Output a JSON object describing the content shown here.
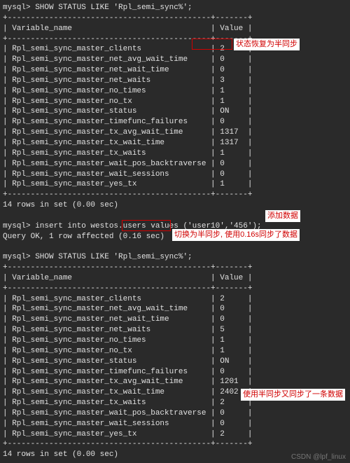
{
  "prompt1": "mysql> SHOW STATUS LIKE 'Rpl_semi_sync%';",
  "header1": "| Variable_name                              | Value |",
  "sep_top1": "+--------------------------------------------+-------+",
  "sep_mid1": "+--------------------------------------------+-------+",
  "sep_bot1": "+--------------------------------------------+-------+",
  "rows1": [
    "| Rpl_semi_sync_master_clients               | 2     |",
    "| Rpl_semi_sync_master_net_avg_wait_time     | 0     |",
    "| Rpl_semi_sync_master_net_wait_time         | 0     |",
    "| Rpl_semi_sync_master_net_waits             | 3     |",
    "| Rpl_semi_sync_master_no_times              | 1     |",
    "| Rpl_semi_sync_master_no_tx                 | 1     |",
    "| Rpl_semi_sync_master_status                | ON    |",
    "| Rpl_semi_sync_master_timefunc_failures     | 0     |",
    "| Rpl_semi_sync_master_tx_avg_wait_time      | 1317  |",
    "| Rpl_semi_sync_master_tx_wait_time          | 1317  |",
    "| Rpl_semi_sync_master_tx_waits              | 1     |",
    "| Rpl_semi_sync_master_wait_pos_backtraverse | 0     |",
    "| Rpl_semi_sync_master_wait_sessions         | 0     |",
    "| Rpl_semi_sync_master_yes_tx                | 1     |"
  ],
  "footer1": "14 rows in set (0.00 sec)",
  "prompt2": "mysql> insert into westos.users values ('user10','456');",
  "result2": "Query OK, 1 row affected (0.16 sec)",
  "prompt3": "mysql> SHOW STATUS LIKE 'Rpl_semi_sync%';",
  "header2": "| Variable_name                              | Value |",
  "rows2": [
    "| Rpl_semi_sync_master_clients               | 2     |",
    "| Rpl_semi_sync_master_net_avg_wait_time     | 0     |",
    "| Rpl_semi_sync_master_net_wait_time         | 0     |",
    "| Rpl_semi_sync_master_net_waits             | 5     |",
    "| Rpl_semi_sync_master_no_times              | 1     |",
    "| Rpl_semi_sync_master_no_tx                 | 1     |",
    "| Rpl_semi_sync_master_status                | ON    |",
    "| Rpl_semi_sync_master_timefunc_failures     | 0     |",
    "| Rpl_semi_sync_master_tx_avg_wait_time      | 1201  |",
    "| Rpl_semi_sync_master_tx_wait_time          | 2402  |",
    "| Rpl_semi_sync_master_tx_waits              | 2     |",
    "| Rpl_semi_sync_master_wait_pos_backtraverse | 0     |",
    "| Rpl_semi_sync_master_wait_sessions         | 0     |",
    "| Rpl_semi_sync_master_yes_tx                | 2     |"
  ],
  "footer2": "14 rows in set (0.00 sec)",
  "ann_status_reset": "状态恢复为半同步",
  "ann_add_data": "添加数据",
  "ann_switch": "切换为半同步, 使用0.16s同步了数据",
  "ann_synced": "使用半同步又同步了一条数据",
  "watermark": "CSDN @lpf_linux"
}
